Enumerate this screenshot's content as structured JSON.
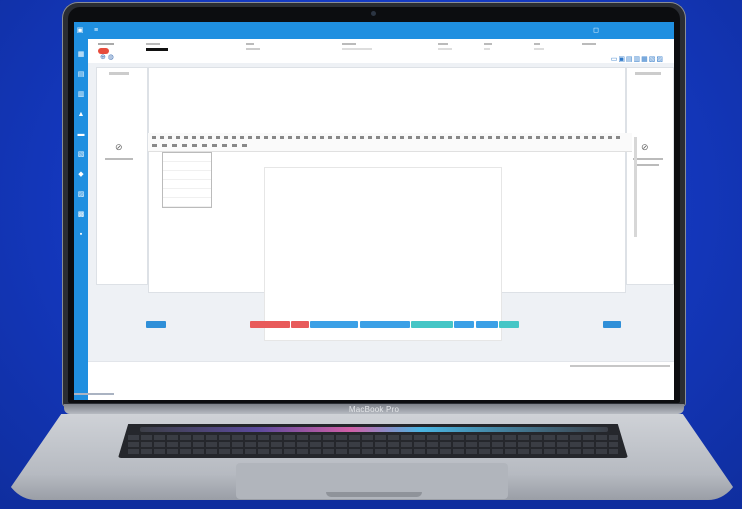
{
  "device": {
    "brand_label": "MacBook Pro"
  },
  "app": {
    "topbar_right": "",
    "header": {
      "status_badge": "",
      "fields": [
        "",
        "",
        "",
        "",
        "",
        "",
        "",
        ""
      ]
    },
    "editor": {
      "style_options": [
        "",
        "",
        "",
        "",
        "",
        ""
      ]
    },
    "buttons": [
      {
        "label": "",
        "color": "#2f8fd8"
      },
      {
        "label": "",
        "color": "#e85a5a"
      },
      {
        "label": "",
        "color": "#e85a5a"
      },
      {
        "label": "",
        "color": "#3ba0e6"
      },
      {
        "label": "",
        "color": "#3ba0e6"
      },
      {
        "label": "",
        "color": "#45c6c6"
      },
      {
        "label": "",
        "color": "#3ba0e6"
      },
      {
        "label": "",
        "color": "#3ba0e6"
      },
      {
        "label": "",
        "color": "#45c6c6"
      },
      {
        "label": "",
        "color": "#2f8fd8"
      }
    ]
  },
  "colors": {
    "background": "#1438bf",
    "app_primary": "#1f8fe0"
  }
}
